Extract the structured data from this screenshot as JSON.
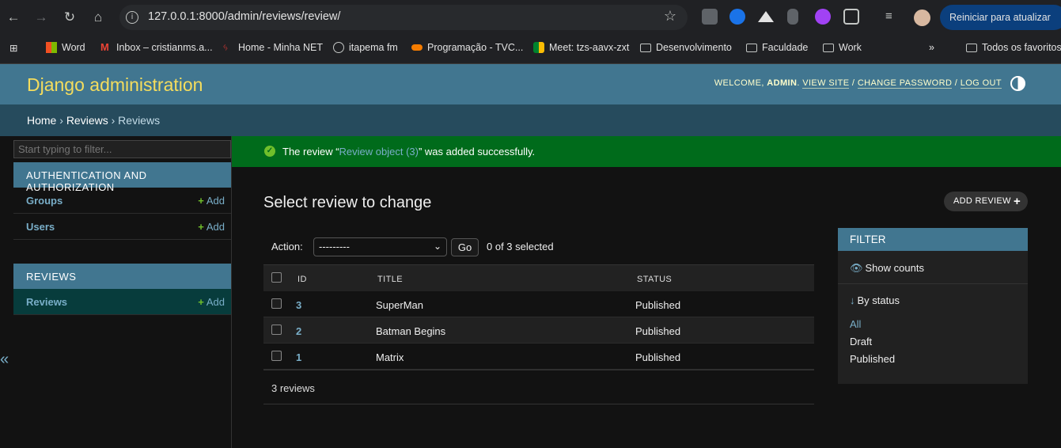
{
  "browser": {
    "url": "127.0.0.1:8000/admin/reviews/review/",
    "relaunch_label": "Reiniciar para atualizar"
  },
  "bookmarks": [
    {
      "label": "Word",
      "icon": "microsoft-icon"
    },
    {
      "label": "Inbox – cristianms.a...",
      "icon": "gmail-icon"
    },
    {
      "label": "Home - Minha NET",
      "icon": "net-icon"
    },
    {
      "label": "itapema fm",
      "icon": "globe-icon"
    },
    {
      "label": "Programação - TVC...",
      "icon": "tv-icon"
    },
    {
      "label": "Meet: tzs-aavx-zxt",
      "icon": "meet-icon"
    },
    {
      "label": "Desenvolvimento",
      "icon": "folder-icon"
    },
    {
      "label": "Faculdade",
      "icon": "folder-icon"
    },
    {
      "label": "Work",
      "icon": "folder-icon"
    }
  ],
  "bookmarks_more": "»",
  "bookmarks_all": "Todos os favoritos",
  "header": {
    "brand": "Django administration",
    "welcome": "WELCOME,",
    "user": "ADMIN",
    "view_site": "VIEW SITE",
    "change_password": "CHANGE PASSWORD",
    "log_out": "LOG OUT"
  },
  "breadcrumbs": {
    "home": "Home",
    "app": "Reviews",
    "model": "Reviews",
    "sep": "›"
  },
  "sidebar": {
    "filter_placeholder": "Start typing to filter...",
    "auth_caption": "AUTHENTICATION AND AUTHORIZATION",
    "auth_items": [
      {
        "label": "Groups",
        "add": "Add"
      },
      {
        "label": "Users",
        "add": "Add"
      }
    ],
    "reviews_caption": "REVIEWS",
    "reviews_items": [
      {
        "label": "Reviews",
        "add": "Add"
      }
    ],
    "collapse": "«"
  },
  "message": {
    "prefix": "The review “",
    "link": "Review object (3)",
    "suffix": "” was added successfully."
  },
  "main": {
    "title": "Select review to change",
    "add_button": "ADD REVIEW",
    "action_label": "Action:",
    "action_value": "---------",
    "go": "Go",
    "selected": "0 of 3 selected",
    "columns": [
      "ID",
      "TITLE",
      "STATUS"
    ],
    "rows": [
      {
        "id": "3",
        "title": "SuperMan",
        "status": "Published"
      },
      {
        "id": "2",
        "title": "Batman Begins",
        "status": "Published"
      },
      {
        "id": "1",
        "title": "Matrix",
        "status": "Published"
      }
    ],
    "count": "3 reviews"
  },
  "filter": {
    "title": "FILTER",
    "show_counts": "Show counts",
    "by_status": "By status",
    "options": [
      "All",
      "Draft",
      "Published"
    ],
    "selected": "All"
  },
  "colors": {
    "header_bg": "#417690",
    "brand": "#f5dd5d",
    "link": "#79aec8",
    "success_bg": "#006b1b",
    "add_plus": "#70bf2b"
  }
}
